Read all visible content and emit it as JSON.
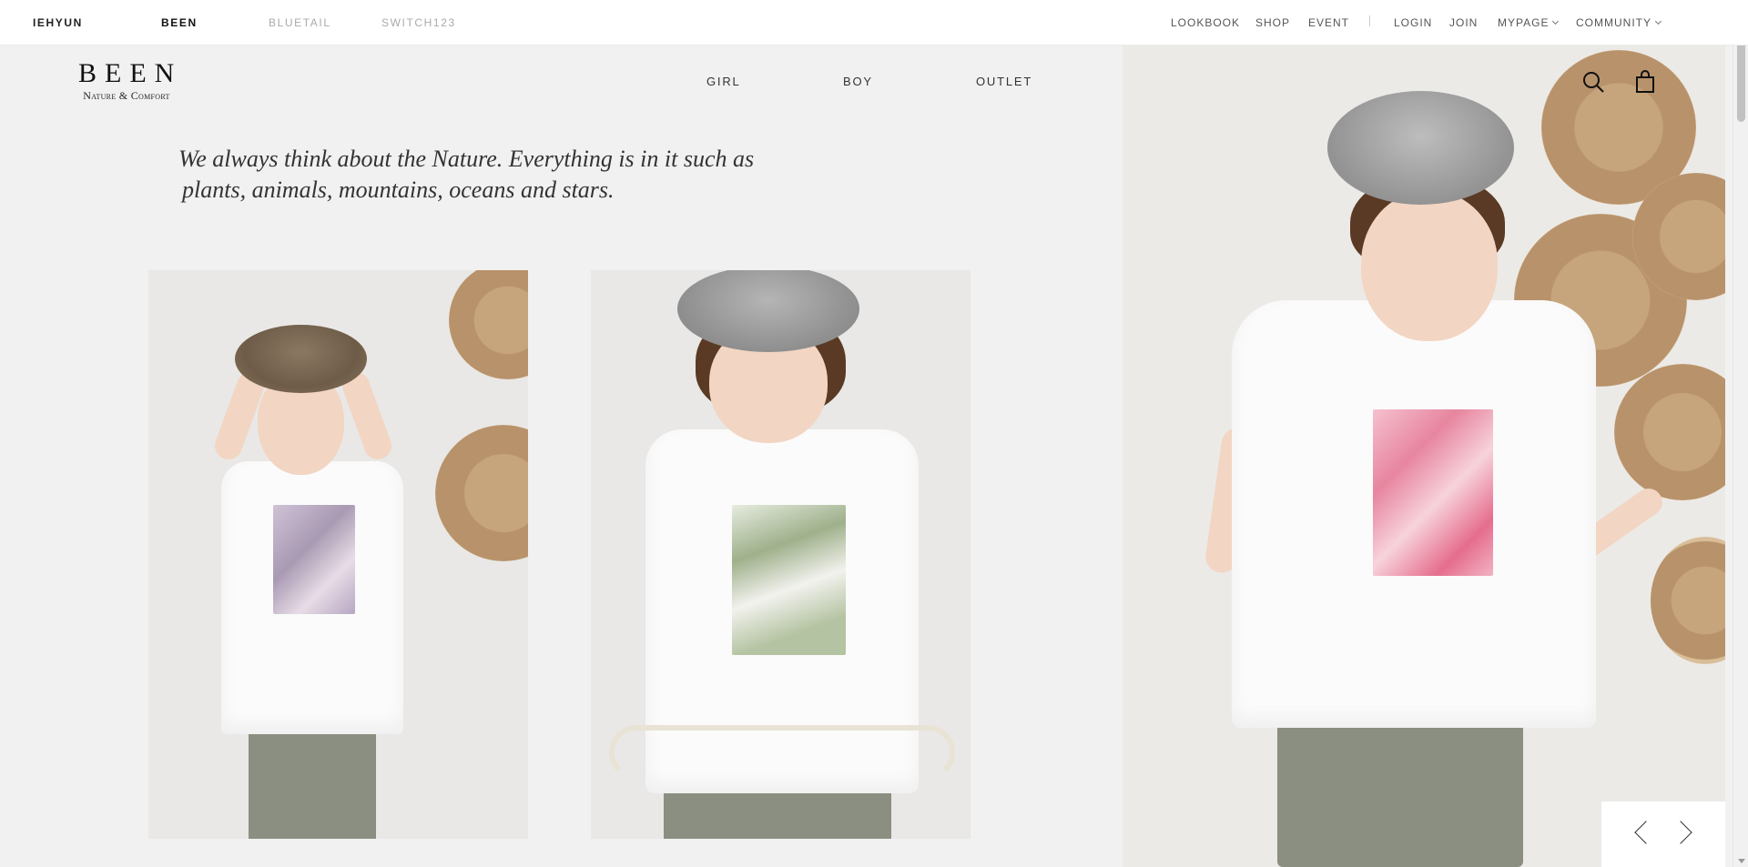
{
  "brands": [
    {
      "label": "IEHYUN",
      "active": true
    },
    {
      "label": "BEEN",
      "active": true
    },
    {
      "label": "BLUETAIL",
      "active": false
    },
    {
      "label": "SWITCH123",
      "active": false
    }
  ],
  "utility_nav": {
    "lookbook": "LOOKBOOK",
    "shop": "SHOP",
    "event": "EVENT",
    "login": "LOGIN",
    "join": "JOIN",
    "mypage": "MYPAGE",
    "community": "COMMUNITY"
  },
  "logo": {
    "word": "BEEN",
    "tagline": "Nature & Comfort"
  },
  "main_nav": {
    "girl": "GIRL",
    "boy": "BOY",
    "outlet": "OUTLET"
  },
  "slogan": {
    "line1": "We always think about the Nature. Everything is in it such as",
    "line2": "plants, animals, mountains, oceans and stars."
  },
  "header_icons": [
    "search-icon",
    "shopping-bag-icon"
  ],
  "slider_controls": [
    "chevron-left-icon",
    "chevron-right-icon"
  ],
  "colors": {
    "background": "#f1f1f1",
    "text": "#333333",
    "muted": "#aaaaaa"
  }
}
